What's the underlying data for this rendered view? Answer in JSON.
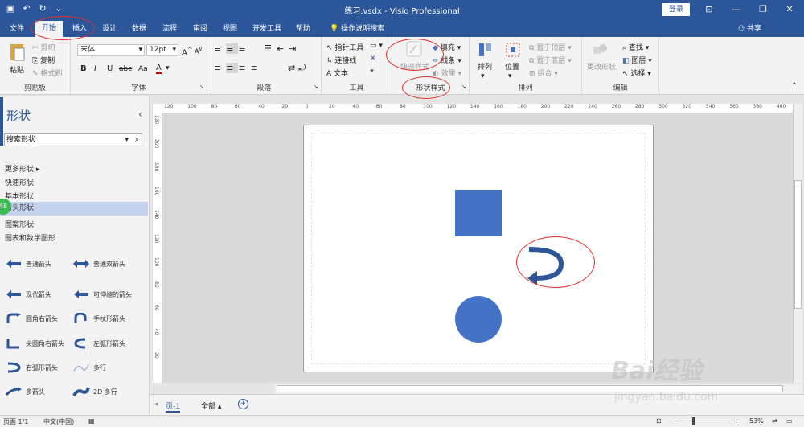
{
  "window": {
    "title": "练习.vsdx  -  Visio Professional",
    "login_label": "登录"
  },
  "tabs": {
    "items": [
      "文件",
      "开始",
      "插入",
      "设计",
      "数据",
      "流程",
      "审阅",
      "视图",
      "开发工具",
      "帮助"
    ],
    "active": "开始",
    "search": "操作说明搜索",
    "share": "共享"
  },
  "ribbon": {
    "clipboard": {
      "paste": "粘贴",
      "cut": "剪切",
      "copy": "复制",
      "format_painter": "格式刷",
      "label": "剪贴板"
    },
    "font": {
      "font_name": "宋体",
      "font_size": "12pt",
      "label": "字体",
      "bold": "B",
      "italic": "I",
      "underline": "U",
      "strike": "abc",
      "case": "Aa",
      "color": "A",
      "grow": "A",
      "shrink": "A"
    },
    "paragraph": {
      "label": "段落"
    },
    "tools": {
      "pointer": "指针工具",
      "connector": "连接线",
      "text": "文本",
      "label": "工具"
    },
    "shape_styles": {
      "quick_styles": "快速样式",
      "fill": "填充",
      "line": "线条",
      "effects": "效果",
      "label": "形状样式"
    },
    "arrange": {
      "arrange": "排列",
      "position": "位置",
      "bring_front": "置于顶层",
      "send_back": "置于底层",
      "group": "组合",
      "label": "排列"
    },
    "editing": {
      "change_shape": "更改形状",
      "find": "查找",
      "layers": "图层",
      "select": "选择",
      "label": "编辑"
    }
  },
  "shapes_pane": {
    "title": "形状",
    "search_placeholder": "搜索形状",
    "more_shapes": "更多形状",
    "stencils": [
      "快速形状",
      "基本形状",
      "箭头形状",
      "图案形状",
      "图表和数学图形"
    ],
    "selected_stencil": "箭头形状",
    "badge": "48",
    "shapes": [
      [
        "普通箭头",
        "普通双箭头"
      ],
      [
        "现代箭头",
        "可伸缩的箭头"
      ],
      [
        "圆角右箭头",
        "手杖形箭头"
      ],
      [
        "尖圆角右箭头",
        "左弧形箭头"
      ],
      [
        "右弧形箭头",
        "多行"
      ],
      [
        "多箭头",
        "2D 多行"
      ]
    ]
  },
  "rulers": {
    "h_ticks": [
      "120",
      "100",
      "80",
      "60",
      "40",
      "20",
      "0",
      "20",
      "40",
      "60",
      "80",
      "100",
      "120",
      "140",
      "160",
      "180",
      "200",
      "220",
      "240",
      "260",
      "280",
      "300",
      "320",
      "340",
      "360",
      "380",
      "400"
    ],
    "v_ticks": [
      "220",
      "200",
      "180",
      "160",
      "140",
      "120",
      "100",
      "80",
      "60",
      "40",
      "20"
    ]
  },
  "page_tabs": {
    "page": "页-1",
    "all": "全部"
  },
  "status": {
    "page": "页面 1/1",
    "lang": "中文(中国)",
    "zoom": "53%"
  },
  "colors": {
    "accent": "#2b579a",
    "shape_fill": "#4472c4",
    "arrow_fill": "#2e5597"
  },
  "watermark": {
    "brand": "Bai经验",
    "url": "jingyan.baidu.com"
  }
}
